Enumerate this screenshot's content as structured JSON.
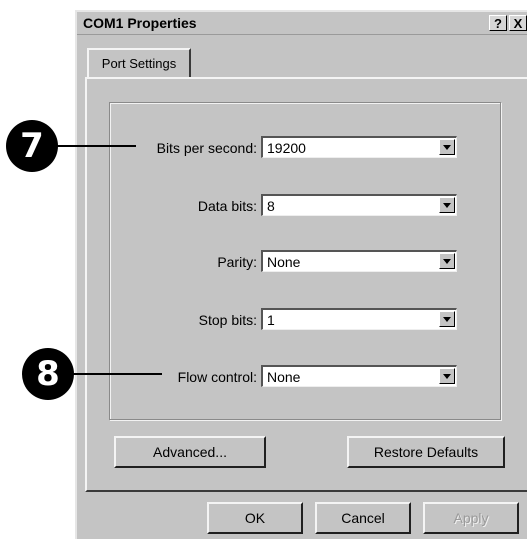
{
  "window": {
    "title": "COM1 Properties",
    "help_label": "?",
    "close_label": "X"
  },
  "tabs": [
    {
      "label": "Port Settings"
    }
  ],
  "fields": [
    {
      "label": "Bits per second:",
      "value": "19200"
    },
    {
      "label": "Data bits:",
      "value": "8"
    },
    {
      "label": "Parity:",
      "value": "None"
    },
    {
      "label": "Stop bits:",
      "value": "1"
    },
    {
      "label": "Flow control:",
      "value": "None"
    }
  ],
  "panel_buttons": {
    "advanced": "Advanced...",
    "restore": "Restore Defaults"
  },
  "footer_buttons": {
    "ok": "OK",
    "cancel": "Cancel",
    "apply": "Apply"
  },
  "callouts": [
    "7",
    "8"
  ]
}
